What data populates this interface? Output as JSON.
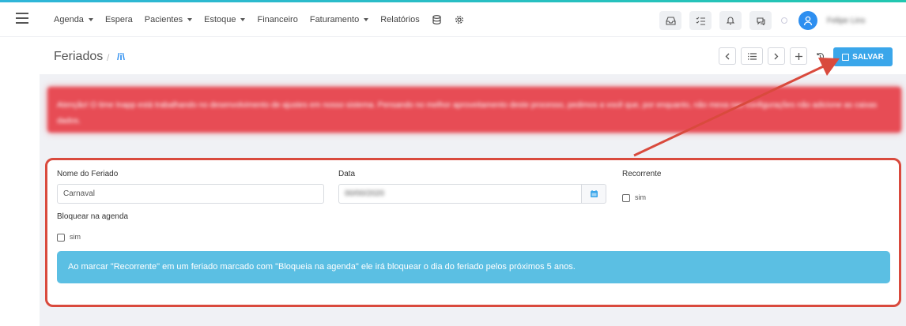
{
  "nav": {
    "menu": [
      {
        "label": "Agenda",
        "dropdown": true
      },
      {
        "label": "Espera",
        "dropdown": false
      },
      {
        "label": "Pacientes",
        "dropdown": true
      },
      {
        "label": "Estoque",
        "dropdown": true
      },
      {
        "label": "Financeiro",
        "dropdown": false
      },
      {
        "label": "Faturamento",
        "dropdown": true
      },
      {
        "label": "Relatórios",
        "dropdown": false
      }
    ],
    "extra_icons": [
      "database-icon",
      "settings-gear-icon"
    ],
    "right_icons": [
      "inbox-icon",
      "checklist-icon",
      "bell-icon",
      "chat-icon"
    ],
    "username": "Felipe Lins"
  },
  "page": {
    "title": "Feriados",
    "breadcrumb_separator": "/",
    "breadcrumb_icon": "/i\\"
  },
  "toolbar": {
    "save_label": "SALVAR",
    "buttons": [
      "previous-icon",
      "list-icon",
      "next-icon",
      "add-icon",
      "history-icon"
    ]
  },
  "alert": {
    "text": "Atenção! O time Inapp está trabalhando no desenvolvimento de ajustes em nosso sistema. Pensando no melhor aproveitamento deste processo, pedimos a você que, por enquanto, não mexa nas configurações não adicione as caixas dados."
  },
  "form": {
    "holiday_name_label": "Nome do Feriado",
    "holiday_name_value": "Carnaval",
    "date_label": "Data",
    "date_value": "00/00/2020",
    "recurring_label": "Recorrente",
    "recurring_option": "sim",
    "block_label": "Bloquear na agenda",
    "block_option": "sim",
    "info": "Ao marcar \"Recorrente\" em um feriado marcado com \"Bloqueia na agenda\" ele irá bloquear o dia do feriado pelos próximos 5 anos."
  },
  "colors": {
    "accent": "#3aa6ea",
    "alert": "#e74c55",
    "highlight": "#d94a3d",
    "info": "#5bbfe3"
  }
}
